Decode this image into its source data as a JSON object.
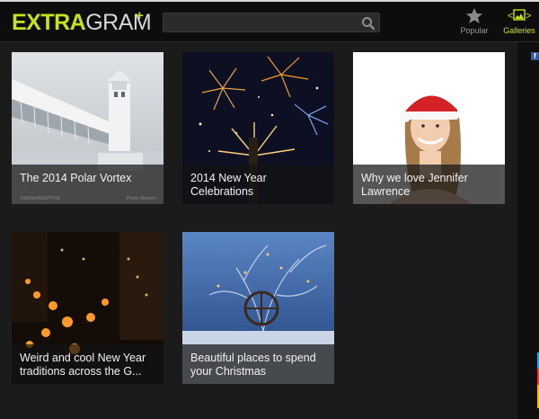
{
  "header": {
    "logo_extra": "EXTRA",
    "logo_gram": "GRAM",
    "logo_plus": "+",
    "search_placeholder": "",
    "nav": [
      {
        "label": "Popular",
        "icon": "star-icon"
      },
      {
        "label": "Galleries",
        "icon": "image-icon"
      }
    ]
  },
  "sidebar": {
    "facebook_label": "f"
  },
  "galleries": [
    {
      "title": "The 2014 Polar Vortex",
      "credit_left": "©WENN/ADAPTIVE",
      "credit_right": "Photo: Reuters"
    },
    {
      "title": "2014 New Year Celebrations"
    },
    {
      "title": "Why we love Jennifer Lawrence"
    },
    {
      "title": "Weird and cool New Year traditions across the G..."
    },
    {
      "title": "Beautiful places to spend your Christmas"
    }
  ],
  "colors": {
    "accent": "#c7e21c",
    "background": "#1b1b1b",
    "header": "#0d0d0d"
  }
}
